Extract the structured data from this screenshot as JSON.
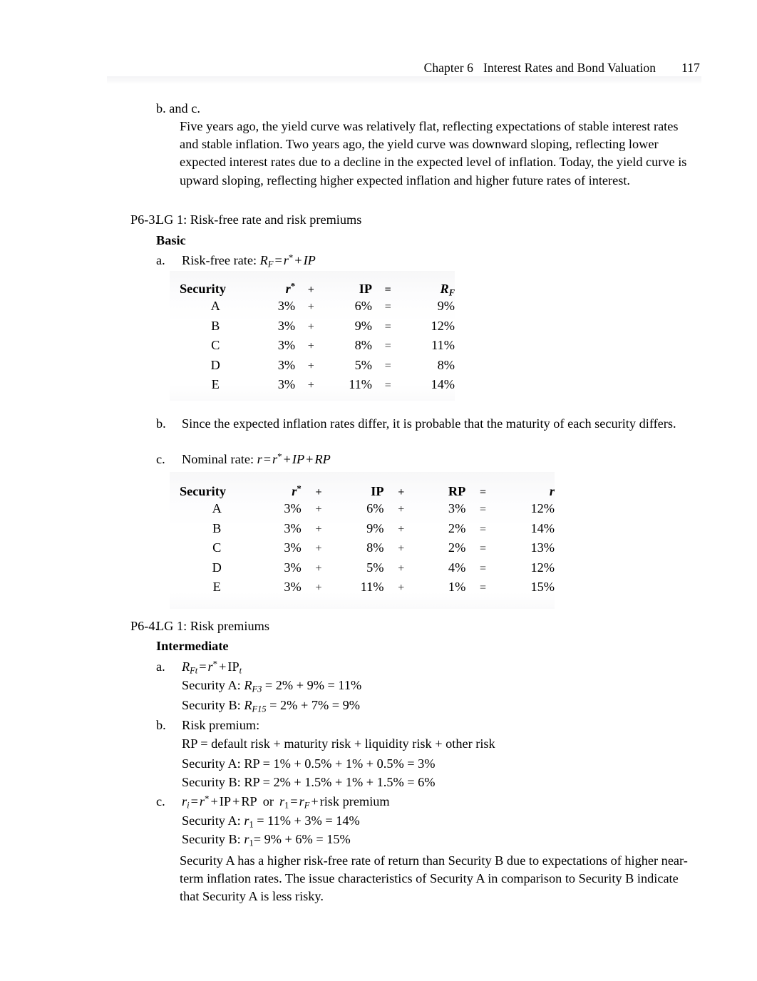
{
  "header": {
    "chapter": "Chapter 6",
    "title": "Interest Rates and Bond Valuation",
    "page_number": "117"
  },
  "sections": {
    "bc_marker": "b. and c.",
    "bc_paragraph": "Five years ago, the yield curve was relatively flat, reflecting expectations of stable interest rates and stable inflation. Two years ago, the yield curve was downward sloping, reflecting lower expected interest rates due to a decline in the expected level of inflation. Today, the yield curve is upward sloping, reflecting higher expected inflation and higher future rates of interest.",
    "p63": {
      "label": "P6-3.",
      "title": "LG 1: Risk-free rate and risk premiums",
      "difficulty": "Basic",
      "a_marker": "a.",
      "a_text": "Risk-free rate:",
      "a_formula": {
        "lhs": "R",
        "lhs_sub": "F",
        "eq": "=",
        "r": "r",
        "star": "*",
        "plus": "+",
        "ip": "IP"
      },
      "b_marker": "b.",
      "b_text": "Since the expected inflation rates differ, it is probable that the maturity of each security differs.",
      "c_marker": "c.",
      "c_text": "Nominal rate:",
      "c_formula": {
        "lhs": "r",
        "eq": "=",
        "r": "r",
        "star": "*",
        "plus1": "+",
        "ip": "IP",
        "plus2": "+",
        "rp": "RP"
      }
    },
    "p64": {
      "label": "P6-4.",
      "title": "LG 1: Risk premiums",
      "difficulty": "Intermediate",
      "a_marker": "a.",
      "a_formula": {
        "lhs": "R",
        "lhs_sub": "Ft",
        "eq": "=",
        "r": "r",
        "star": "*",
        "plus": "+",
        "ip": "IP",
        "ip_sub": "t"
      },
      "a_lines": [
        {
          "prefix": "Security A: ",
          "sym": "R",
          "sub": "F3",
          "rest": " = 2% + 9% = 11%"
        },
        {
          "prefix": "Security B: ",
          "sym": "R",
          "sub": "F15",
          "rest": " = 2% + 7% = 9%"
        }
      ],
      "b_marker": "b.",
      "b_text": "Risk premium:",
      "b_definition": "RP = default risk + maturity risk + liquidity risk + other risk",
      "b_lines": [
        "Security A: RP = 1% + 0.5% + 1% + 0.5% = 3%",
        "Security B: RP = 2% + 1.5% + 1% + 1.5% = 6%"
      ],
      "c_marker": "c.",
      "c_formula": {
        "r1": "r",
        "r1_sub": "i",
        "eq1": "=",
        "r2": "r",
        "star": "*",
        "plus1": "+",
        "ip": "IP",
        "plus2": "+",
        "rp": "RP",
        "or": "or",
        "r3": "r",
        "r3_sub": "1",
        "eq2": "=",
        "r4": "r",
        "r4_sub": "F",
        "plus3": "+",
        "risk_premium": "risk premium"
      },
      "c_lines": [
        {
          "prefix": "Security A: ",
          "sym": "r",
          "sub": "1",
          "rest": " = 11% + 3% = 14%"
        },
        {
          "prefix": "Security B: ",
          "sym": "r",
          "sub": "1",
          "rest": "= 9% + 6% = 15%"
        }
      ],
      "closing_paragraph": "Security A has a higher risk-free rate of return than Security B due to expectations of higher near-term inflation rates. The issue characteristics of Security A in comparison to Security B indicate that Security A is less risky."
    }
  },
  "table_rf": {
    "headers": {
      "security": "Security",
      "r_star_base": "r",
      "r_star_sup": "*",
      "op1": "+",
      "ip": "IP",
      "op2": "=",
      "result_base": "R",
      "result_sub": "F"
    },
    "rows": [
      {
        "security": "A",
        "r_star": "3%",
        "op1": "+",
        "ip": "6%",
        "op2": "=",
        "result": "9%"
      },
      {
        "security": "B",
        "r_star": "3%",
        "op1": "+",
        "ip": "9%",
        "op2": "=",
        "result": "12%"
      },
      {
        "security": "C",
        "r_star": "3%",
        "op1": "+",
        "ip": "8%",
        "op2": "=",
        "result": "11%"
      },
      {
        "security": "D",
        "r_star": "3%",
        "op1": "+",
        "ip": "5%",
        "op2": "=",
        "result": "8%"
      },
      {
        "security": "E",
        "r_star": "3%",
        "op1": "+",
        "ip": "11%",
        "op2": "=",
        "result": "14%"
      }
    ]
  },
  "table_nominal": {
    "headers": {
      "security": "Security",
      "r_star_base": "r",
      "r_star_sup": "*",
      "op1": "+",
      "ip": "IP",
      "op2": "+",
      "rp": "RP",
      "op3": "=",
      "result": "r"
    },
    "rows": [
      {
        "security": "A",
        "r_star": "3%",
        "op1": "+",
        "ip": "6%",
        "op2": "+",
        "rp": "3%",
        "op3": "=",
        "result": "12%"
      },
      {
        "security": "B",
        "r_star": "3%",
        "op1": "+",
        "ip": "9%",
        "op2": "+",
        "rp": "2%",
        "op3": "=",
        "result": "14%"
      },
      {
        "security": "C",
        "r_star": "3%",
        "op1": "+",
        "ip": "8%",
        "op2": "+",
        "rp": "2%",
        "op3": "=",
        "result": "13%"
      },
      {
        "security": "D",
        "r_star": "3%",
        "op1": "+",
        "ip": "5%",
        "op2": "+",
        "rp": "4%",
        "op3": "=",
        "result": "12%"
      },
      {
        "security": "E",
        "r_star": "3%",
        "op1": "+",
        "ip": "11%",
        "op2": "+",
        "rp": "1%",
        "op3": "=",
        "result": "15%"
      }
    ]
  }
}
